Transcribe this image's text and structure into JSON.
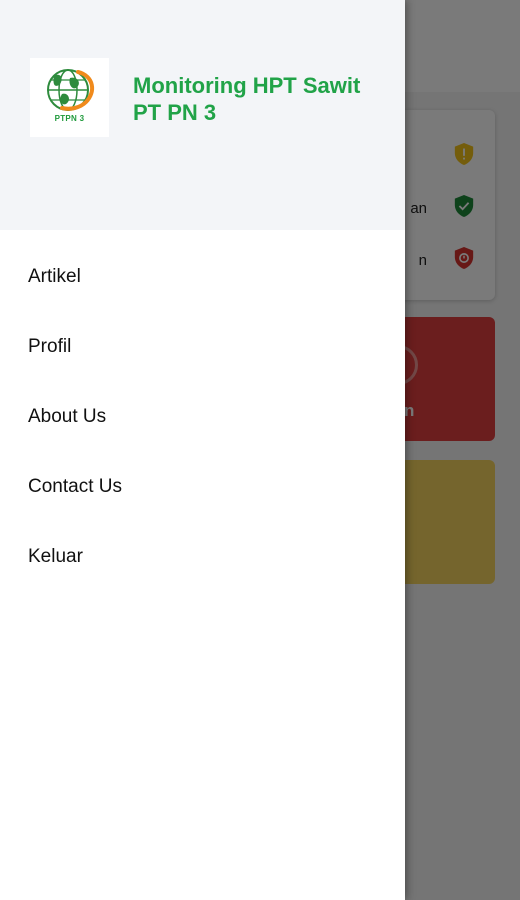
{
  "drawer": {
    "app_title": "Monitoring HPT Sawit PT PN 3",
    "logo_text": "PTPN 3",
    "menu_items": [
      {
        "label": "Artikel",
        "name": "menu-item-artikel"
      },
      {
        "label": "Profil",
        "name": "menu-item-profil"
      },
      {
        "label": "About Us",
        "name": "menu-item-about-us"
      },
      {
        "label": "Contact Us",
        "name": "menu-item-contact-us"
      },
      {
        "label": "Keluar",
        "name": "menu-item-keluar"
      }
    ]
  },
  "background": {
    "status_rows": [
      {
        "text": "",
        "icon": "shield-warning-icon",
        "color": "#f2c31a"
      },
      {
        "text": "an",
        "icon": "shield-check-icon",
        "color": "#1e8a3a"
      },
      {
        "text": "n",
        "icon": "shield-alert-icon",
        "color": "#d8342f"
      }
    ],
    "red_tile_label": "n"
  },
  "colors": {
    "accent": "#21a348",
    "scrim": "rgba(0,0,0,0.52)",
    "red_tile": "#e0403f",
    "yellow_tile": "#f4d35e"
  }
}
